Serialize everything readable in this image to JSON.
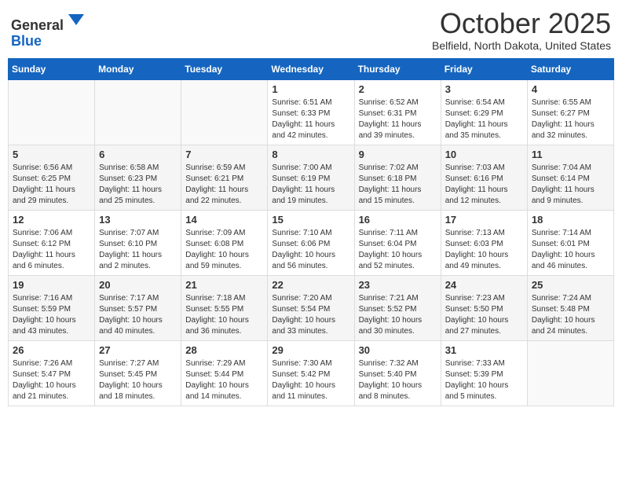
{
  "header": {
    "logo_general": "General",
    "logo_blue": "Blue",
    "month_title": "October 2025",
    "location": "Belfield, North Dakota, United States"
  },
  "weekdays": [
    "Sunday",
    "Monday",
    "Tuesday",
    "Wednesday",
    "Thursday",
    "Friday",
    "Saturday"
  ],
  "weeks": [
    [
      {
        "day": "",
        "sunrise": "",
        "sunset": "",
        "daylight": ""
      },
      {
        "day": "",
        "sunrise": "",
        "sunset": "",
        "daylight": ""
      },
      {
        "day": "",
        "sunrise": "",
        "sunset": "",
        "daylight": ""
      },
      {
        "day": "1",
        "sunrise": "Sunrise: 6:51 AM",
        "sunset": "Sunset: 6:33 PM",
        "daylight": "Daylight: 11 hours and 42 minutes."
      },
      {
        "day": "2",
        "sunrise": "Sunrise: 6:52 AM",
        "sunset": "Sunset: 6:31 PM",
        "daylight": "Daylight: 11 hours and 39 minutes."
      },
      {
        "day": "3",
        "sunrise": "Sunrise: 6:54 AM",
        "sunset": "Sunset: 6:29 PM",
        "daylight": "Daylight: 11 hours and 35 minutes."
      },
      {
        "day": "4",
        "sunrise": "Sunrise: 6:55 AM",
        "sunset": "Sunset: 6:27 PM",
        "daylight": "Daylight: 11 hours and 32 minutes."
      }
    ],
    [
      {
        "day": "5",
        "sunrise": "Sunrise: 6:56 AM",
        "sunset": "Sunset: 6:25 PM",
        "daylight": "Daylight: 11 hours and 29 minutes."
      },
      {
        "day": "6",
        "sunrise": "Sunrise: 6:58 AM",
        "sunset": "Sunset: 6:23 PM",
        "daylight": "Daylight: 11 hours and 25 minutes."
      },
      {
        "day": "7",
        "sunrise": "Sunrise: 6:59 AM",
        "sunset": "Sunset: 6:21 PM",
        "daylight": "Daylight: 11 hours and 22 minutes."
      },
      {
        "day": "8",
        "sunrise": "Sunrise: 7:00 AM",
        "sunset": "Sunset: 6:19 PM",
        "daylight": "Daylight: 11 hours and 19 minutes."
      },
      {
        "day": "9",
        "sunrise": "Sunrise: 7:02 AM",
        "sunset": "Sunset: 6:18 PM",
        "daylight": "Daylight: 11 hours and 15 minutes."
      },
      {
        "day": "10",
        "sunrise": "Sunrise: 7:03 AM",
        "sunset": "Sunset: 6:16 PM",
        "daylight": "Daylight: 11 hours and 12 minutes."
      },
      {
        "day": "11",
        "sunrise": "Sunrise: 7:04 AM",
        "sunset": "Sunset: 6:14 PM",
        "daylight": "Daylight: 11 hours and 9 minutes."
      }
    ],
    [
      {
        "day": "12",
        "sunrise": "Sunrise: 7:06 AM",
        "sunset": "Sunset: 6:12 PM",
        "daylight": "Daylight: 11 hours and 6 minutes."
      },
      {
        "day": "13",
        "sunrise": "Sunrise: 7:07 AM",
        "sunset": "Sunset: 6:10 PM",
        "daylight": "Daylight: 11 hours and 2 minutes."
      },
      {
        "day": "14",
        "sunrise": "Sunrise: 7:09 AM",
        "sunset": "Sunset: 6:08 PM",
        "daylight": "Daylight: 10 hours and 59 minutes."
      },
      {
        "day": "15",
        "sunrise": "Sunrise: 7:10 AM",
        "sunset": "Sunset: 6:06 PM",
        "daylight": "Daylight: 10 hours and 56 minutes."
      },
      {
        "day": "16",
        "sunrise": "Sunrise: 7:11 AM",
        "sunset": "Sunset: 6:04 PM",
        "daylight": "Daylight: 10 hours and 52 minutes."
      },
      {
        "day": "17",
        "sunrise": "Sunrise: 7:13 AM",
        "sunset": "Sunset: 6:03 PM",
        "daylight": "Daylight: 10 hours and 49 minutes."
      },
      {
        "day": "18",
        "sunrise": "Sunrise: 7:14 AM",
        "sunset": "Sunset: 6:01 PM",
        "daylight": "Daylight: 10 hours and 46 minutes."
      }
    ],
    [
      {
        "day": "19",
        "sunrise": "Sunrise: 7:16 AM",
        "sunset": "Sunset: 5:59 PM",
        "daylight": "Daylight: 10 hours and 43 minutes."
      },
      {
        "day": "20",
        "sunrise": "Sunrise: 7:17 AM",
        "sunset": "Sunset: 5:57 PM",
        "daylight": "Daylight: 10 hours and 40 minutes."
      },
      {
        "day": "21",
        "sunrise": "Sunrise: 7:18 AM",
        "sunset": "Sunset: 5:55 PM",
        "daylight": "Daylight: 10 hours and 36 minutes."
      },
      {
        "day": "22",
        "sunrise": "Sunrise: 7:20 AM",
        "sunset": "Sunset: 5:54 PM",
        "daylight": "Daylight: 10 hours and 33 minutes."
      },
      {
        "day": "23",
        "sunrise": "Sunrise: 7:21 AM",
        "sunset": "Sunset: 5:52 PM",
        "daylight": "Daylight: 10 hours and 30 minutes."
      },
      {
        "day": "24",
        "sunrise": "Sunrise: 7:23 AM",
        "sunset": "Sunset: 5:50 PM",
        "daylight": "Daylight: 10 hours and 27 minutes."
      },
      {
        "day": "25",
        "sunrise": "Sunrise: 7:24 AM",
        "sunset": "Sunset: 5:48 PM",
        "daylight": "Daylight: 10 hours and 24 minutes."
      }
    ],
    [
      {
        "day": "26",
        "sunrise": "Sunrise: 7:26 AM",
        "sunset": "Sunset: 5:47 PM",
        "daylight": "Daylight: 10 hours and 21 minutes."
      },
      {
        "day": "27",
        "sunrise": "Sunrise: 7:27 AM",
        "sunset": "Sunset: 5:45 PM",
        "daylight": "Daylight: 10 hours and 18 minutes."
      },
      {
        "day": "28",
        "sunrise": "Sunrise: 7:29 AM",
        "sunset": "Sunset: 5:44 PM",
        "daylight": "Daylight: 10 hours and 14 minutes."
      },
      {
        "day": "29",
        "sunrise": "Sunrise: 7:30 AM",
        "sunset": "Sunset: 5:42 PM",
        "daylight": "Daylight: 10 hours and 11 minutes."
      },
      {
        "day": "30",
        "sunrise": "Sunrise: 7:32 AM",
        "sunset": "Sunset: 5:40 PM",
        "daylight": "Daylight: 10 hours and 8 minutes."
      },
      {
        "day": "31",
        "sunrise": "Sunrise: 7:33 AM",
        "sunset": "Sunset: 5:39 PM",
        "daylight": "Daylight: 10 hours and 5 minutes."
      },
      {
        "day": "",
        "sunrise": "",
        "sunset": "",
        "daylight": ""
      }
    ]
  ]
}
